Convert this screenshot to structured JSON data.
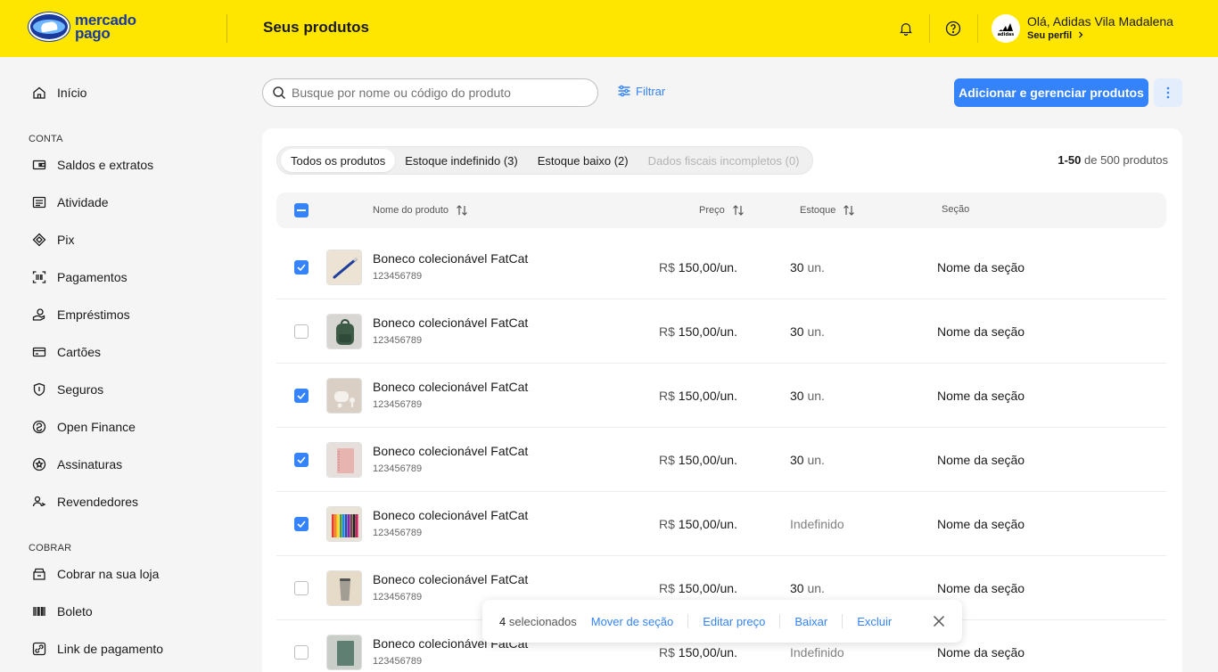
{
  "header": {
    "logo_line1": "mercado",
    "logo_line2": "pago",
    "title": "Seus produtos",
    "greeting": "Olá, Adidas Vila Madalena",
    "profile_link": "Seu perfil",
    "avatar_brand": "adidas"
  },
  "sidebar": {
    "home": "Início",
    "section_conta": "CONTA",
    "conta_items": [
      {
        "label": "Saldos e extratos",
        "icon": "wallet-icon"
      },
      {
        "label": "Atividade",
        "icon": "activity-icon"
      },
      {
        "label": "Pix",
        "icon": "pix-icon"
      },
      {
        "label": "Pagamentos",
        "icon": "barcode-scan-icon"
      },
      {
        "label": "Empréstimos",
        "icon": "loan-icon"
      },
      {
        "label": "Cartões",
        "icon": "card-icon"
      },
      {
        "label": "Seguros",
        "icon": "shield-icon"
      },
      {
        "label": "Open Finance",
        "icon": "open-finance-icon"
      },
      {
        "label": "Assinaturas",
        "icon": "subscription-icon"
      },
      {
        "label": "Revendedores",
        "icon": "resellers-icon"
      }
    ],
    "section_cobrar": "COBRAR",
    "cobrar_items": [
      {
        "label": "Cobrar na sua loja",
        "icon": "store-icon"
      },
      {
        "label": "Boleto",
        "icon": "barcode-icon"
      },
      {
        "label": "Link de pagamento",
        "icon": "link-icon"
      }
    ]
  },
  "toolbar": {
    "search_placeholder": "Busque por nome ou código do produto",
    "filter_label": "Filtrar",
    "add_label": "Adicionar e gerenciar produtos"
  },
  "tabs": [
    {
      "label": "Todos os produtos",
      "state": "active"
    },
    {
      "label": "Estoque indefinido (3)",
      "state": "normal"
    },
    {
      "label": "Estoque baixo (2)",
      "state": "normal"
    },
    {
      "label": "Dados fiscais incompletos (0)",
      "state": "disabled"
    }
  ],
  "count": {
    "range": "1-50",
    "rest": "de 500 produtos"
  },
  "table": {
    "headers": {
      "name": "Nome do produto",
      "price": "Preço",
      "stock": "Estoque",
      "section": "Seção"
    },
    "rows": [
      {
        "checked": true,
        "name": "Boneco colecionável FatCat",
        "code": "123456789",
        "currency": "R$",
        "price": "150,00/un.",
        "stock_num": "30",
        "stock_unit": "un.",
        "section": "Nome da seção",
        "thumb": "pen"
      },
      {
        "checked": false,
        "name": "Boneco colecionável FatCat",
        "code": "123456789",
        "currency": "R$",
        "price": "150,00/un.",
        "stock_num": "30",
        "stock_unit": "un.",
        "section": "Nome da seção",
        "thumb": "backpack"
      },
      {
        "checked": true,
        "name": "Boneco colecionável FatCat",
        "code": "123456789",
        "currency": "R$",
        "price": "150,00/un.",
        "stock_num": "30",
        "stock_unit": "un.",
        "section": "Nome da seção",
        "thumb": "earbuds"
      },
      {
        "checked": true,
        "name": "Boneco colecionável FatCat",
        "code": "123456789",
        "currency": "R$",
        "price": "150,00/un.",
        "stock_num": "30",
        "stock_unit": "un.",
        "section": "Nome da seção",
        "thumb": "notebook"
      },
      {
        "checked": true,
        "name": "Boneco colecionável FatCat",
        "code": "123456789",
        "currency": "R$",
        "price": "150,00/un.",
        "stock_num": "",
        "stock_unit": "Indefinido",
        "section": "Nome da seção",
        "thumb": "pencils"
      },
      {
        "checked": false,
        "name": "Boneco colecionável FatCat",
        "code": "123456789",
        "currency": "R$",
        "price": "150,00/un.",
        "stock_num": "30",
        "stock_unit": "un.",
        "section": "Nome da seção",
        "thumb": "tumbler"
      },
      {
        "checked": false,
        "name": "Boneco colecionável FatCat",
        "code": "123456789",
        "currency": "R$",
        "price": "150,00/un.",
        "stock_num": "",
        "stock_unit": "Indefinido",
        "section": "Nome da seção",
        "thumb": "green-notebook"
      }
    ]
  },
  "actionbar": {
    "count": "4",
    "selected_label": "selecionados",
    "move": "Mover de seção",
    "edit_price": "Editar preço",
    "download": "Baixar",
    "delete": "Excluir"
  },
  "colors": {
    "brand_yellow": "#ffe600",
    "accent_blue": "#3483fa"
  }
}
